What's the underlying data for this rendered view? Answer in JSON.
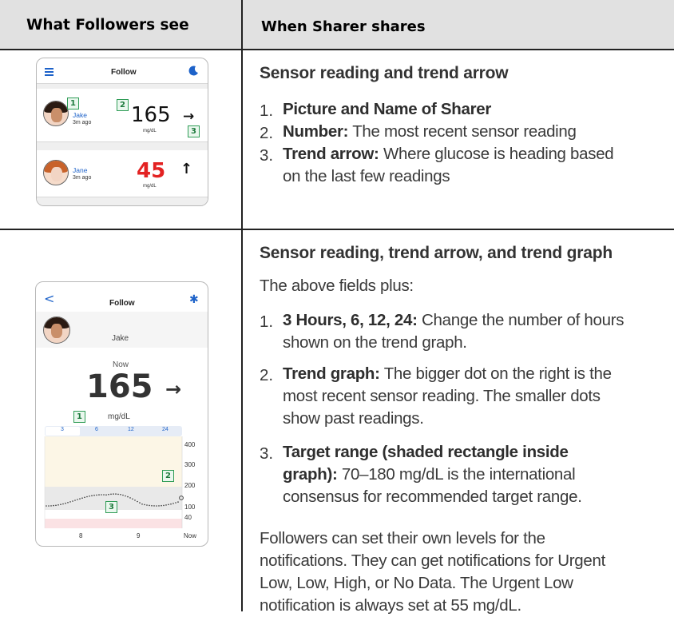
{
  "headers": {
    "left": "What Followers see",
    "right": "When Sharer shares"
  },
  "section1": {
    "title": "Sensor reading and trend arrow",
    "items": [
      {
        "num": "1.",
        "bold": "Picture and Name of Sharer",
        "text": ""
      },
      {
        "num": "2.",
        "bold": "Number:",
        "text": " The most recent sensor reading"
      },
      {
        "num": "3.",
        "bold": "Trend arrow:",
        "text_lines": [
          " Where glucose is heading based",
          "on the last few readings"
        ]
      }
    ]
  },
  "section2": {
    "title": "Sensor reading, trend arrow, and trend graph",
    "intro": "The above fields plus:",
    "items": [
      {
        "num": "1.",
        "bold": "3 Hours, 6, 12, 24:",
        "lines": [
          " Change the number of hours",
          "shown on the trend graph."
        ]
      },
      {
        "num": "2.",
        "bold": "Trend graph:",
        "lines": [
          " The bigger dot on the right is the",
          "most recent sensor reading. The smaller dots",
          "show past readings."
        ]
      },
      {
        "num": "3.",
        "bold_lines": [
          "Target range (shaded rectangle inside",
          "graph):"
        ],
        "lines": [
          " 70–180 mg/dL is the international",
          "consensus for recommended target range."
        ]
      }
    ],
    "footer_lines": [
      "Followers can set their own levels for the",
      "notifications. They can get notifications for Urgent",
      "Low, Low, High, or No Data. The Urgent Low",
      "notification is always set at 55 mg/dL."
    ]
  },
  "phone1": {
    "title": "Follow",
    "menu_icon": "hamburger-menu-icon",
    "night_icon": "moon-icon",
    "rows": [
      {
        "name": "Jake",
        "time": "3m ago",
        "value": "165",
        "unit": "mg/dL",
        "arrow": "→",
        "color": "#111111"
      },
      {
        "name": "Jane",
        "time": "3m ago",
        "value": "45",
        "unit": "mg/dL",
        "arrow": "↑",
        "color": "#e32222"
      }
    ],
    "badges": [
      "1",
      "2",
      "3"
    ]
  },
  "phone2": {
    "title": "Follow",
    "back_icon": "back-chevron-icon",
    "settings_icon": "gear-icon",
    "name": "Jake",
    "now_label": "Now",
    "value": "165",
    "arrow": "→",
    "unit": "mg/dL",
    "tabs": [
      "3",
      "6",
      "12",
      "24"
    ],
    "selected_tab": "3",
    "y_ticks": [
      "400",
      "300",
      "200",
      "100",
      "40"
    ],
    "x_ticks": [
      "8",
      "9",
      "Now"
    ],
    "badges": [
      "1",
      "2",
      "3"
    ],
    "colors": {
      "accent": "#1d62c9",
      "target_band": "#fcf6e6",
      "low_band": "#fbe2e4",
      "badge_border": "#2f9c56"
    }
  }
}
